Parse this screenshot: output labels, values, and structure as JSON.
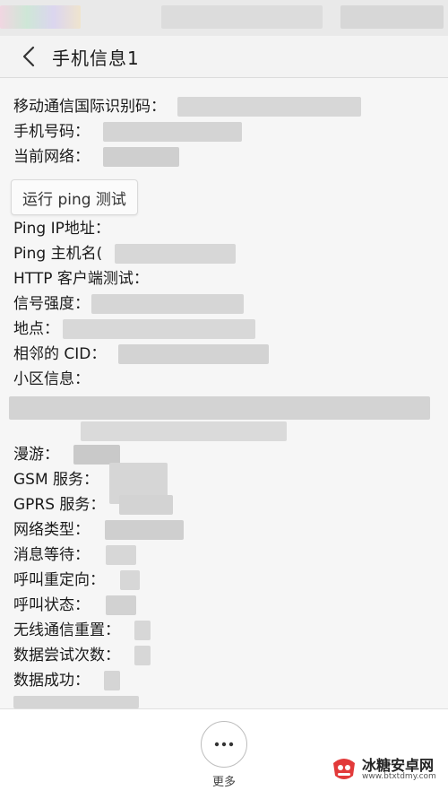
{
  "header": {
    "title": "手机信息1"
  },
  "fields": {
    "imei": "移动通信国际识别码：",
    "phone": "手机号码：",
    "network": "当前网络：",
    "ping_ip": "Ping IP地址：",
    "ping_host": "Ping 主机名(",
    "http_test": "HTTP 客户端测试：",
    "signal": "信号强度：",
    "location": "地点：",
    "cid": "相邻的 CID：",
    "cell_info": "小区信息：",
    "roaming": "漫游：",
    "gsm": "GSM 服务：",
    "gprs": "GPRS 服务：",
    "net_type": "网络类型：",
    "msg_wait": "消息等待：",
    "call_redirect": "呼叫重定向：",
    "call_state": "呼叫状态：",
    "radio_reset": "无线通信重置：",
    "data_attempts": "数据尝试次数：",
    "data_success": "数据成功："
  },
  "ping_button": {
    "label": "运行 ping 测试"
  },
  "bottom": {
    "more_label": "更多"
  },
  "watermark": {
    "name": "冰糖安卓网",
    "url": "www.btxtdmy.com"
  },
  "colors": {
    "blur": "#d6d6d6",
    "blur_dark": "#cacaca",
    "accent": "#e23a3a"
  }
}
